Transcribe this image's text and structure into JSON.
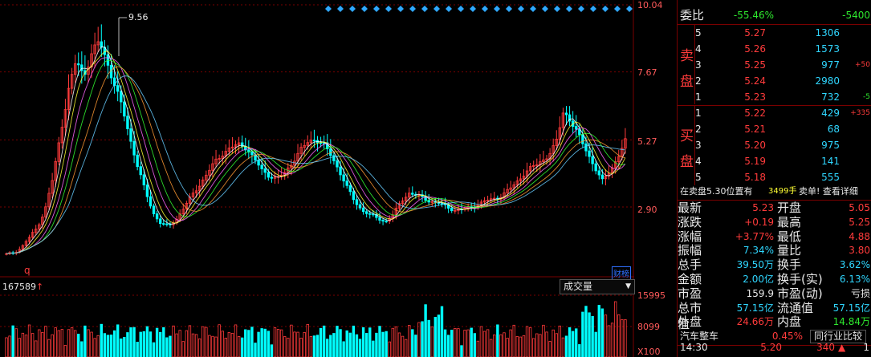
{
  "chart": {
    "peak_label": "9.56",
    "price_ticks": [
      "10.04",
      "7.67",
      "5.27",
      "2.90"
    ],
    "volume_ticks": [
      "15995",
      "8099",
      "X100"
    ],
    "volume_readout": "167589",
    "volume_dropdown": "成交量",
    "q_marker": "q",
    "cai_bang": "财榜",
    "colors": {
      "up": "#ff3b3b",
      "down": "#00ffff",
      "grid": "#7a0000"
    }
  },
  "chart_data": {
    "type": "candlestick",
    "ylim": [
      1.0,
      10.04
    ],
    "price_ticks": [
      10.04,
      7.67,
      5.27,
      2.9
    ],
    "close": [
      1.2,
      1.3,
      1.5,
      1.8,
      2.2,
      2.8,
      3.9,
      5.5,
      7.0,
      8.1,
      7.5,
      8.3,
      8.8,
      8.0,
      7.2,
      6.4,
      5.3,
      4.3,
      3.4,
      2.7,
      2.3,
      2.2,
      2.5,
      2.9,
      3.3,
      3.7,
      4.1,
      4.5,
      4.8,
      5.0,
      5.1,
      5.0,
      4.6,
      4.2,
      4.0,
      3.9,
      4.1,
      4.5,
      4.9,
      5.2,
      5.3,
      5.1,
      4.7,
      4.2,
      3.6,
      3.1,
      2.8,
      2.6,
      2.5,
      2.4,
      2.6,
      3.1,
      3.4,
      3.3,
      3.2,
      3.1,
      3.0,
      2.9,
      2.8,
      2.8,
      2.9,
      3.0,
      3.1,
      3.2,
      3.3,
      3.5,
      3.8,
      4.1,
      4.3,
      4.5,
      4.7,
      5.1,
      6.3,
      5.9,
      5.4,
      4.9,
      4.3,
      3.8,
      4.2,
      4.6,
      5.23
    ],
    "volume_ylim": [
      0,
      16000
    ]
  },
  "panel": {
    "weibi_label": "委比",
    "weibi_pct": "-55.46%",
    "weibi_val": "-5400",
    "sell_chars": [
      "卖",
      "盘"
    ],
    "buy_chars": [
      "买",
      "盘"
    ],
    "sell": [
      {
        "lvl": "5",
        "price": "5.27",
        "qty": "1306",
        "chg": ""
      },
      {
        "lvl": "4",
        "price": "5.26",
        "qty": "1573",
        "chg": ""
      },
      {
        "lvl": "3",
        "price": "5.25",
        "qty": "977",
        "chg": "+50"
      },
      {
        "lvl": "2",
        "price": "5.24",
        "qty": "2980",
        "chg": ""
      },
      {
        "lvl": "1",
        "price": "5.23",
        "qty": "732",
        "chg": "-5"
      }
    ],
    "buy": [
      {
        "lvl": "1",
        "price": "5.22",
        "qty": "429",
        "chg": "+335"
      },
      {
        "lvl": "2",
        "price": "5.21",
        "qty": "68",
        "chg": ""
      },
      {
        "lvl": "3",
        "price": "5.20",
        "qty": "975",
        "chg": ""
      },
      {
        "lvl": "4",
        "price": "5.19",
        "qty": "141",
        "chg": ""
      },
      {
        "lvl": "5",
        "price": "5.18",
        "qty": "555",
        "chg": ""
      }
    ],
    "notice_prefix": "在卖盘5.30位置有",
    "notice_qty": "3499手",
    "notice_suffix": "卖单! 查看详细",
    "quote": [
      {
        "l1": "最新",
        "v1": "5.23",
        "c1": "red",
        "l2": "开盘",
        "v2": "5.05",
        "c2": "red"
      },
      {
        "l1": "涨跌",
        "v1": "+0.19",
        "c1": "red",
        "l2": "最高",
        "v2": "5.25",
        "c2": "red"
      },
      {
        "l1": "涨幅",
        "v1": "+3.77%",
        "c1": "red",
        "l2": "最低",
        "v2": "4.88",
        "c2": "red"
      },
      {
        "l1": "振幅",
        "v1": "7.34%",
        "c1": "cyan",
        "l2": "量比",
        "v2": "3.80",
        "c2": "red"
      },
      {
        "l1": "总手",
        "v1": "39.50万",
        "c1": "cyan",
        "l2": "换手",
        "v2": "3.62%",
        "c2": "cyan"
      },
      {
        "l1": "金额",
        "v1": "2.00亿",
        "c1": "cyan",
        "l2": "换手(实)",
        "v2": "6.13%",
        "c2": "cyan"
      },
      {
        "l1": "市盈",
        "v1": "159.9",
        "c1": "white",
        "l2": "市盈(动)",
        "v2": "亏损",
        "c2": "white"
      },
      {
        "l1": "总市值",
        "v1": "57.15亿",
        "c1": "cyan",
        "l2": "流通值",
        "v2": "57.15亿",
        "c2": "cyan"
      },
      {
        "l1": "外盘",
        "v1": "24.66万",
        "c1": "red",
        "l2": "内盘",
        "v2": "14.84万",
        "c2": "green"
      }
    ],
    "industry": "汽车整车",
    "industry_pct": "0.45%",
    "industry_btn": "同行业比较",
    "tick": {
      "time": "14:30",
      "price": "5.20",
      "vol": "340",
      "count": "1"
    }
  }
}
